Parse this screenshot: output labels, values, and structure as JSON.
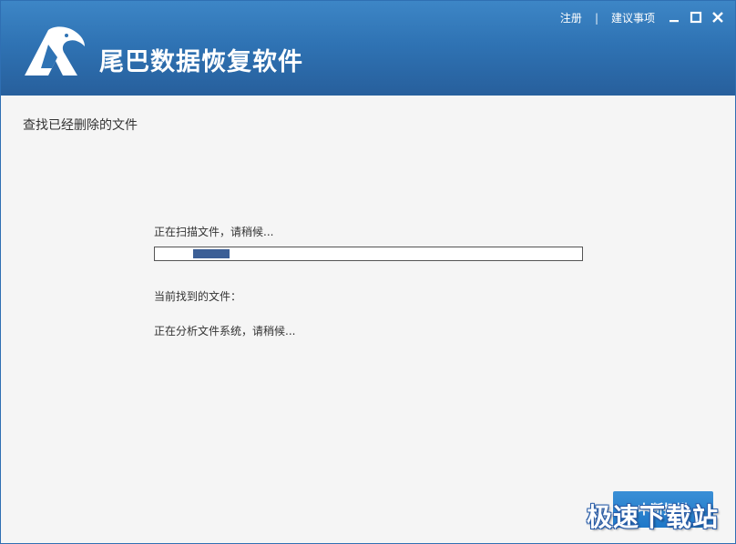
{
  "window": {
    "app_title": "尾巴数据恢复软件",
    "top_links": {
      "register": "注册",
      "separator": "|",
      "feedback": "建议事项"
    },
    "controls": [
      "minimize-icon",
      "maximize-icon",
      "close-icon"
    ]
  },
  "content": {
    "section_title": "查找已经删除的文件",
    "scan_status": "正在扫描文件，请稍候...",
    "progress": {
      "fill_start": 0.09,
      "fill_end": 0.175,
      "fill_color": "#3c5f96"
    },
    "found_label": "当前找到的文件：",
    "analysis_status": "正在分析文件系统，请稍候..."
  },
  "actions": {
    "stop_scan": "中断扫描"
  },
  "watermark": "极速下载站",
  "colors": {
    "header_blue": "#2f73b4",
    "button_blue": "#1f78c8"
  }
}
